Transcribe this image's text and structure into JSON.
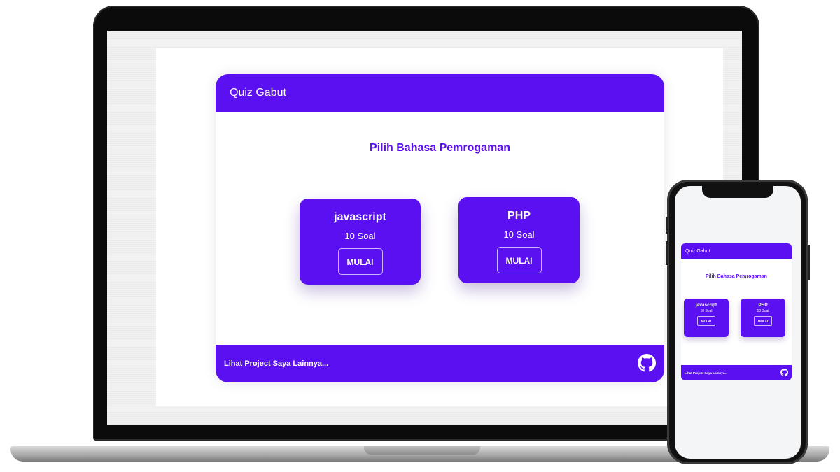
{
  "app": {
    "title": "Quiz Gabut",
    "heading": "Pilih Bahasa Pemrogaman",
    "footer_text": "Lihat Project Saya Lainnya...",
    "footer_icon": "github-icon",
    "accent_color": "#5a10f0"
  },
  "quizzes": [
    {
      "name": "javascript",
      "count": "10 Soal",
      "button": "MULAI"
    },
    {
      "name": "PHP",
      "count": "10 Soal",
      "button": "MULAI"
    }
  ]
}
